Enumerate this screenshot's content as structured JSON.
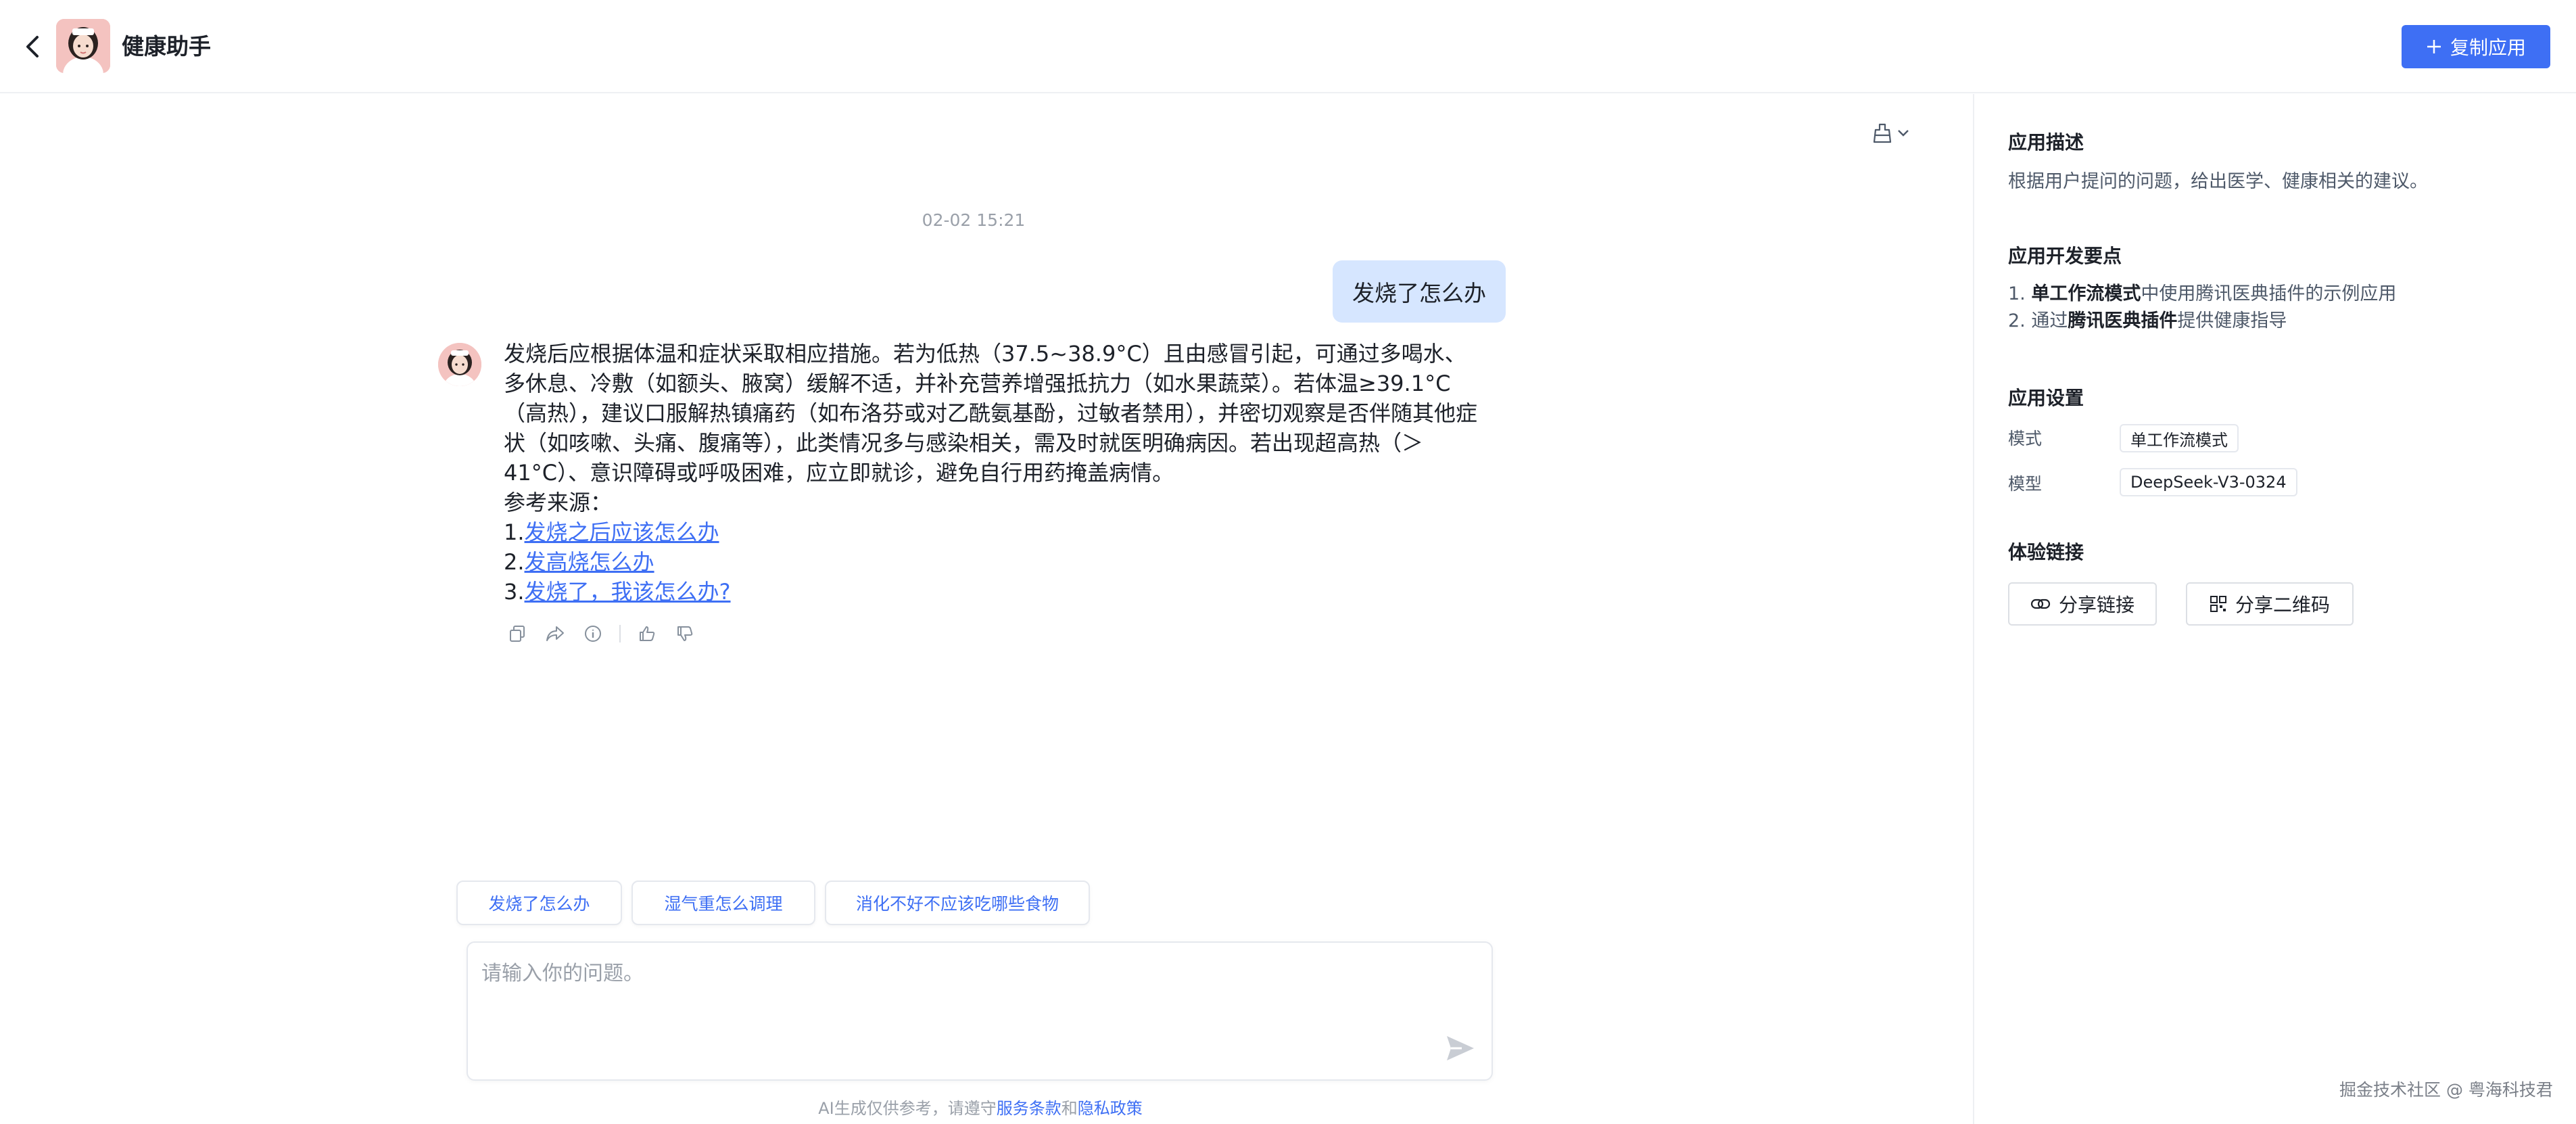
{
  "header": {
    "title": "健康助手",
    "copy_button": "复制应用"
  },
  "chat": {
    "timestamp": "02-02 15:21",
    "user_message": "发烧了怎么办",
    "answer": {
      "paragraph": "发烧后应根据体温和症状采取相应措施。若为低热（37.5~38.9°C）且由感冒引起，可通过多喝水、多休息、冷敷（如额头、腋窝）缓解不适，并补充营养增强抵抗力（如水果蔬菜）。若体温≥39.1°C（高热），建议口服解热镇痛药（如布洛芬或对乙酰氨基酚，过敏者禁用），并密切观察是否伴随其他症状（如咳嗽、头痛、腹痛等），此类情况多与感染相关，需及时就医明确病因。若出现超高热（＞41°C）、意识障碍或呼吸困难，应立即就诊，避免自行用药掩盖病情。",
      "refs_label": "参考来源：",
      "refs": [
        {
          "num": "1.",
          "text": "发烧之后应该怎么办"
        },
        {
          "num": "2.",
          "text": "发高烧怎么办"
        },
        {
          "num": "3.",
          "text": "发烧了，我该怎么办?"
        }
      ]
    },
    "suggestions": [
      "发烧了怎么办",
      "湿气重怎么调理",
      "消化不好不应该吃哪些食物"
    ],
    "input_placeholder": "请输入你的问题。",
    "disclaimer": {
      "prefix": "AI生成仅供参考，请遵守",
      "terms": "服务条款",
      "and": "和",
      "privacy": "隐私政策"
    }
  },
  "panel": {
    "desc_title": "应用描述",
    "desc_text": "根据用户提问的问题，给出医学、健康相关的建议。",
    "dev_title": "应用开发要点",
    "dev_points": [
      {
        "prefix": "1. ",
        "bold": "单工作流模式",
        "rest": "中使用腾讯医典插件的示例应用"
      },
      {
        "prefix": "2. 通过",
        "bold": "腾讯医典插件",
        "rest": "提供健康指导"
      }
    ],
    "settings_title": "应用设置",
    "mode_label": "模式",
    "mode_value": "单工作流模式",
    "model_label": "模型",
    "model_value": "DeepSeek-V3-0324",
    "link_title": "体验链接",
    "share_link": "分享链接",
    "share_qr": "分享二维码"
  },
  "footer_credit": "掘金技术社区 @ 粤海科技君",
  "colors": {
    "accent": "#3e6ff4",
    "user_bubble": "#d6e6ff",
    "muted": "#9aa0a9"
  }
}
